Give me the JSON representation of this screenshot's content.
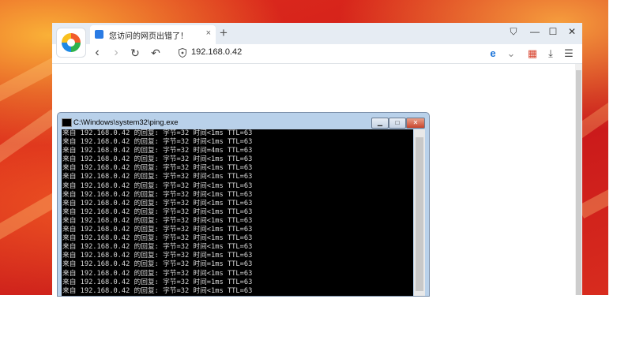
{
  "browser": {
    "tab_title": "您访问的网页出错了！",
    "tab_close": "×",
    "new_tab": "+",
    "window_controls": {
      "skin": "⛉",
      "minimize": "—",
      "maximize": "☐",
      "close": "✕"
    },
    "nav": {
      "back": "‹",
      "forward": "›",
      "refresh": "↻",
      "undo": "↶"
    },
    "url": "192.168.0.42",
    "toolbar_icons": {
      "ie_mode": "e",
      "dropdown": "⌄",
      "apps": "▦",
      "download": "⤓",
      "menu": "☰"
    }
  },
  "cmd_window": {
    "title": "C:\\Windows\\system32\\ping.exe",
    "controls": {
      "minimize": "▁",
      "maximize": "□",
      "close": "✕"
    },
    "lines": [
      "来自 192.168.0.42 的回复: 字节=32 时间<1ms TTL=63",
      "来自 192.168.0.42 的回复: 字节=32 时间<1ms TTL=63",
      "来自 192.168.0.42 的回复: 字节=32 时间=4ms TTL=63",
      "来自 192.168.0.42 的回复: 字节=32 时间<1ms TTL=63",
      "来自 192.168.0.42 的回复: 字节=32 时间<1ms TTL=63",
      "来自 192.168.0.42 的回复: 字节=32 时间<1ms TTL=63",
      "来自 192.168.0.42 的回复: 字节=32 时间<1ms TTL=63",
      "来自 192.168.0.42 的回复: 字节=32 时间<1ms TTL=63",
      "来自 192.168.0.42 的回复: 字节=32 时间<1ms TTL=63",
      "来自 192.168.0.42 的回复: 字节=32 时间<1ms TTL=63",
      "来自 192.168.0.42 的回复: 字节=32 时间<1ms TTL=63",
      "来自 192.168.0.42 的回复: 字节=32 时间<1ms TTL=63",
      "来自 192.168.0.42 的回复: 字节=32 时间<1ms TTL=63",
      "来自 192.168.0.42 的回复: 字节=32 时间<1ms TTL=63",
      "来自 192.168.0.42 的回复: 字节=32 时间=1ms TTL=63",
      "来自 192.168.0.42 的回复: 字节=32 时间=1ms TTL=63",
      "来自 192.168.0.42 的回复: 字节=32 时间<1ms TTL=63",
      "来自 192.168.0.42 的回复: 字节=32 时间=1ms TTL=63",
      "来自 192.168.0.42 的回复: 字节=32 时间<1ms TTL=63"
    ]
  },
  "colors": {
    "desktop_red": "#d4201a",
    "tabbar_bg": "#e6ecf3",
    "console_bg": "#000000",
    "console_text": "#d8d8d8",
    "cmd_frame": "#b9d1ea"
  }
}
